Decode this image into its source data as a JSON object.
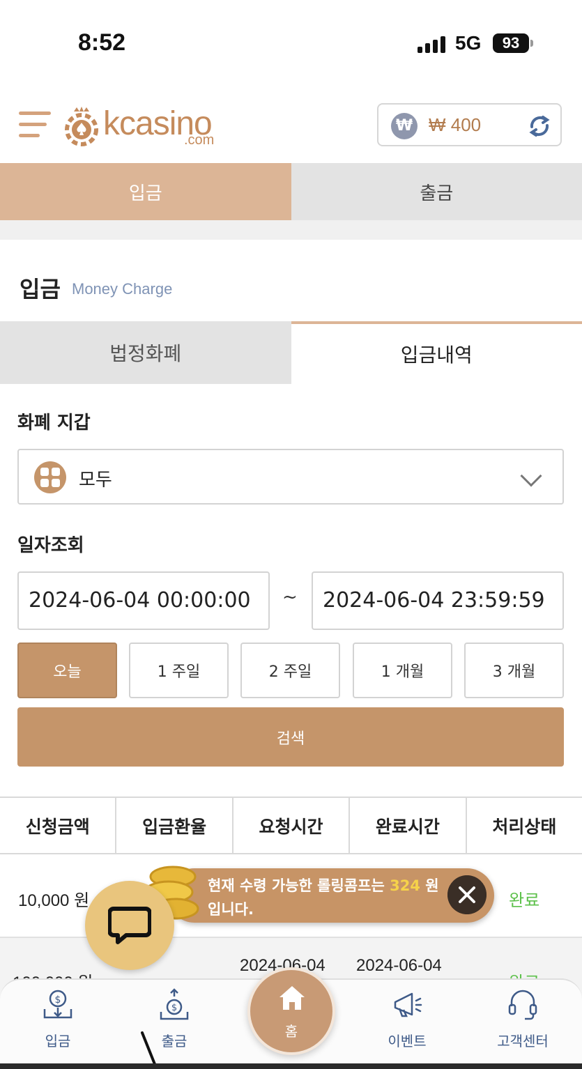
{
  "status_bar": {
    "time": "8:52",
    "network": "5G",
    "battery": "93"
  },
  "header": {
    "logo_text": "kcasino",
    "logo_sub": ".com",
    "balance": "₩ 400",
    "currency_symbol": "₩"
  },
  "top_tabs": [
    {
      "label": "입금",
      "active": true
    },
    {
      "label": "출금",
      "active": false
    }
  ],
  "section": {
    "title": "입금",
    "subtitle": "Money Charge"
  },
  "sub_tabs": [
    {
      "label": "법정화폐",
      "active": false
    },
    {
      "label": "입금내역",
      "active": true
    }
  ],
  "wallet": {
    "label": "화폐 지갑",
    "selected": "모두"
  },
  "date_query": {
    "label": "일자조회",
    "start": "2024-06-04 00:00:00",
    "separator": "~",
    "end": "2024-06-04 23:59:59"
  },
  "periods": [
    {
      "label": "오늘",
      "active": true
    },
    {
      "label": "1 주일",
      "active": false
    },
    {
      "label": "2 주일",
      "active": false
    },
    {
      "label": "1 개월",
      "active": false
    },
    {
      "label": "3 개월",
      "active": false
    }
  ],
  "search_label": "검색",
  "table": {
    "headers": [
      "신청금액",
      "입금환율",
      "요청시간",
      "완료시간",
      "처리상태"
    ],
    "rows": [
      {
        "amount": "10,000 원",
        "status": "완료"
      },
      {
        "amount": "100,000 원",
        "request_time": "2024-06-04",
        "complete_time": "2024-06-04",
        "status": "완료"
      }
    ]
  },
  "notice": {
    "text_before": "현재 수령 가능한 롤링콤프는 ",
    "highlight": "324",
    "text_after": " 원 입니다."
  },
  "bottom_nav": [
    {
      "label": "입금",
      "icon": "deposit-icon"
    },
    {
      "label": "출금",
      "icon": "withdraw-icon"
    },
    {
      "label": "홈",
      "icon": "home-icon"
    },
    {
      "label": "이벤트",
      "icon": "megaphone-icon"
    },
    {
      "label": "고객센터",
      "icon": "headset-icon"
    }
  ],
  "colors": {
    "accent": "#c5956a",
    "tab_active": "#dcb596",
    "status_done": "#5cc04a",
    "nav_label": "#3e5a88",
    "highlight": "#f6d24a"
  }
}
